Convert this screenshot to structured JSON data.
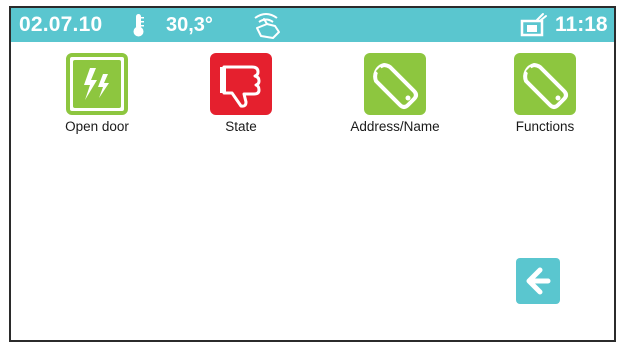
{
  "status_bar": {
    "date": "02.07.10",
    "temperature": "30,3°",
    "time": "11:18",
    "icons": [
      "thermometer-icon",
      "hand-gesture-icon",
      "camera-icon"
    ],
    "color": "#5ac6cf"
  },
  "tiles": [
    {
      "label": "Open door",
      "icon": "lightning-icon",
      "color": "#8dc63f"
    },
    {
      "label": "State",
      "icon": "thumbs-down-icon",
      "color": "#e5202e"
    },
    {
      "label": "Address/Name",
      "icon": "wrench-icon",
      "color": "#8dc63f"
    },
    {
      "label": "Functions",
      "icon": "wrench-icon",
      "color": "#8dc63f"
    }
  ],
  "back_button": {
    "icon": "arrow-left-icon",
    "color": "#5ac6cf"
  }
}
